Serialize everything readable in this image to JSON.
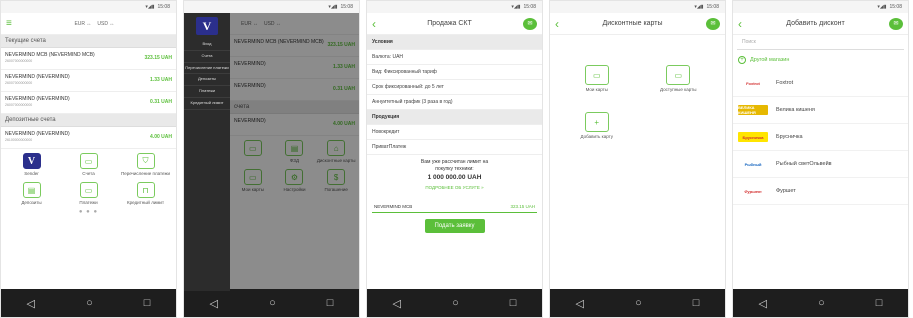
{
  "status": {
    "time": "15:08"
  },
  "nav": {
    "back": "◁",
    "home": "○",
    "recent": "□"
  },
  "screen1": {
    "currency": [
      "EUR ↔",
      "USD ↔"
    ],
    "sections": {
      "current": "Текущие счета",
      "deposit": "Депозитные счета"
    },
    "accounts": [
      {
        "name": "NEVERMIND MCB (NEVERMIND MCB)",
        "sub": "26007000000000",
        "amount": "323.15 UAH"
      },
      {
        "name": "NEVERMIND (NEVERMIND)",
        "sub": "26007000000000",
        "amount": "1.33 UAH"
      },
      {
        "name": "NEVERMIND (NEVERMIND)",
        "sub": "26007000000000",
        "amount": "0.31 UAH"
      }
    ],
    "deposit_accounts": [
      {
        "name": "NEVERMIND (NEVERMIND)",
        "sub": "26100000000000",
        "amount": "4.00 UAH"
      }
    ],
    "tiles": [
      "Sender",
      "Счета",
      "Перечисление платежи",
      "Депозиты",
      "Платежи",
      "Кредитный лимит"
    ]
  },
  "screen2": {
    "currency": [
      "EUR ↔",
      "USD ↔"
    ],
    "drawer": [
      "Вход",
      "Счета",
      "Перечисление платежи",
      "Депозиты",
      "Платежи",
      "Кредитный лимит"
    ],
    "account_rows": [
      {
        "name": "NEVERMIND MCB (NEVERMIND MCB)",
        "amount": "323.15 UAH"
      },
      {
        "name": "NEVERMIND)",
        "amount": "1.33 UAH"
      },
      {
        "name": "NEVERMIND)",
        "amount": "0.31 UAH"
      },
      {
        "name": "NEVERMIND)",
        "amount": "4.00 UAH"
      }
    ],
    "section": "счета",
    "tiles": [
      "",
      "ФЗД",
      "Дисконтные карты",
      "Мои карты",
      "Настройки",
      "Погашение"
    ]
  },
  "screen3": {
    "title": "Продажа СКТ",
    "rows": [
      "Условия",
      "Валюта: UAH",
      "Вид: Фиксированный тариф",
      "Срок фиксированный: до 5 лет",
      "Аннуитетный график (3 раза в год)",
      "Продукция",
      "Новокредит",
      "ПриватПлатеж"
    ],
    "promo": {
      "line1": "Вам уже рассчитан лимит на",
      "line2": "покупку техники:",
      "amount": "1 000 000.00 UAH",
      "link": "ПОДРОБНЕЕ ОБ УСЛУГЕ »"
    },
    "select": {
      "label": "NEVERMIND MCB",
      "amount": "323.15 UAH"
    },
    "button": "Подать заявку"
  },
  "screen4": {
    "title": "Дисконтные карты",
    "tiles": [
      "Мои карты",
      "Доступные карты",
      "Добавить карту"
    ]
  },
  "screen5": {
    "title": "Добавить дисконт",
    "search_placeholder": "Поиск",
    "other": "Другой магазин",
    "shops": [
      {
        "logo": "Foxtrot",
        "name": "Foxtrot",
        "color": "#d32f2f",
        "bg": "#ffffff"
      },
      {
        "logo": "ВЕЛИКА КИШЕНЯ",
        "name": "Велика кишеня",
        "color": "#ffffff",
        "bg": "#e6b800"
      },
      {
        "logo": "Брусничка",
        "name": "Брусничка",
        "color": "#d32f2f",
        "bg": "#ffe500"
      },
      {
        "logo": "Рыбный",
        "name": "Рыбный светОльвейв",
        "color": "#1565c0",
        "bg": "#ffffff"
      },
      {
        "logo": "Фуршет",
        "name": "Фуршет",
        "color": "#d32f2f",
        "bg": "#ffffff"
      }
    ]
  },
  "colors": {
    "accent": "#5bbf3a",
    "brand": "#2b2f8c"
  }
}
